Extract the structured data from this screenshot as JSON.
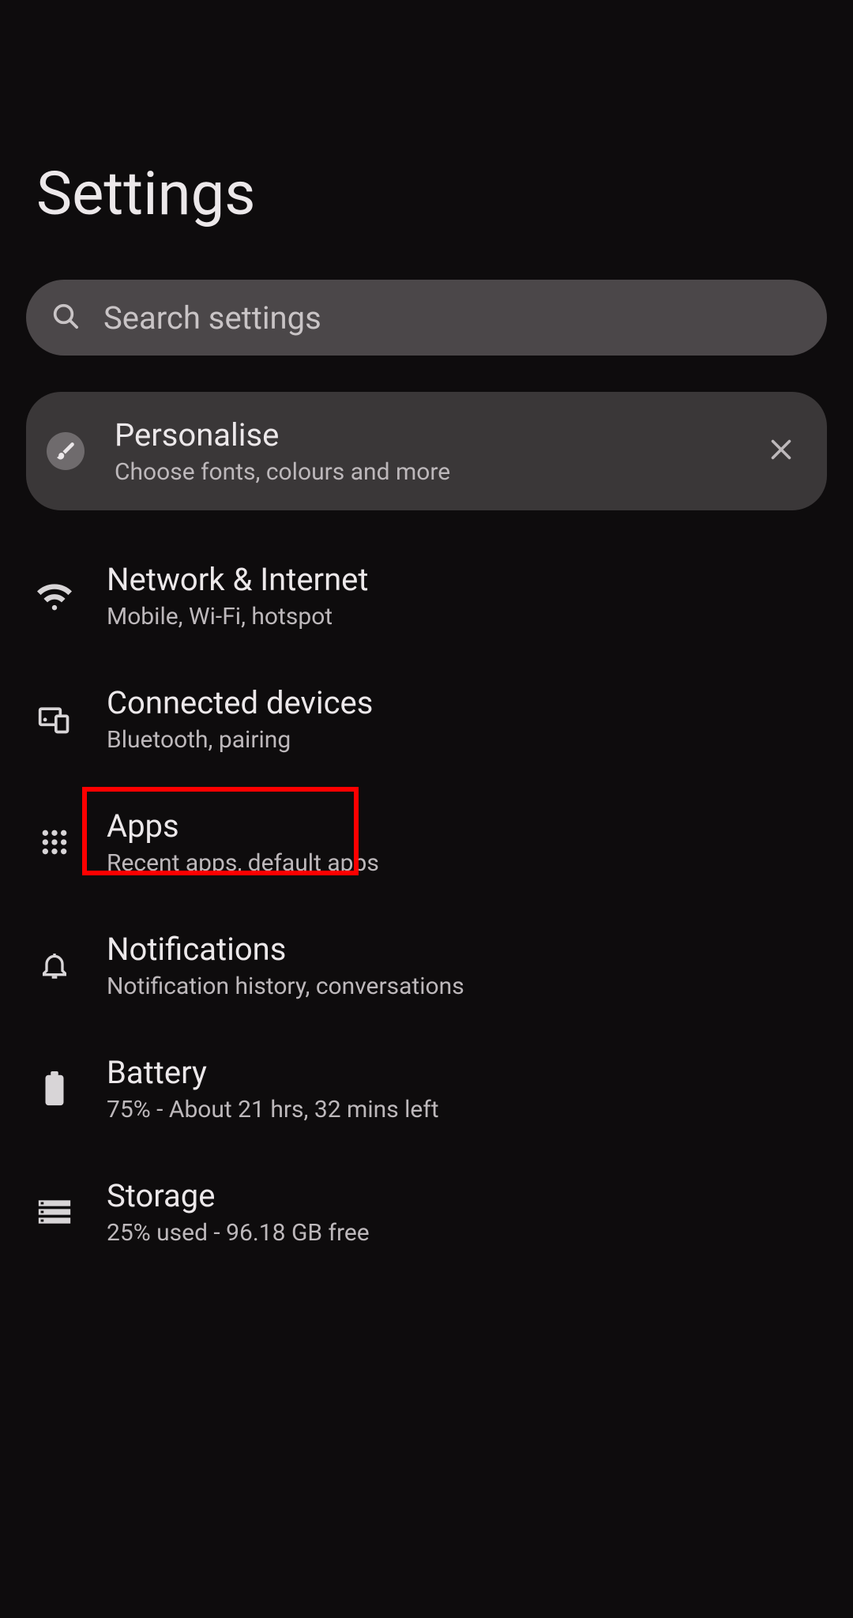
{
  "header": {
    "title": "Settings"
  },
  "search": {
    "placeholder": "Search settings"
  },
  "promo": {
    "title": "Personalise",
    "subtitle": "Choose fonts, colours and more"
  },
  "items": [
    {
      "title": "Network & Internet",
      "subtitle": "Mobile, Wi-Fi, hotspot"
    },
    {
      "title": "Connected devices",
      "subtitle": "Bluetooth, pairing"
    },
    {
      "title": "Apps",
      "subtitle": "Recent apps, default apps"
    },
    {
      "title": "Notifications",
      "subtitle": "Notification history, conversations"
    },
    {
      "title": "Battery",
      "subtitle": "75% - About 21 hrs, 32 mins left"
    },
    {
      "title": "Storage",
      "subtitle": "25% used - 96.18 GB free"
    }
  ]
}
